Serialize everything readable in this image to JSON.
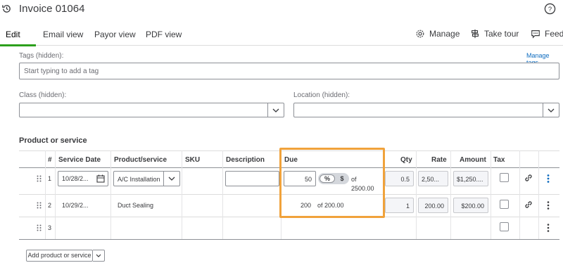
{
  "header": {
    "title": "Invoice 01064"
  },
  "tabs": [
    {
      "label": "Edit"
    },
    {
      "label": "Email view"
    },
    {
      "label": "Payor view"
    },
    {
      "label": "PDF view"
    }
  ],
  "actions": {
    "manage": "Manage",
    "take_tour": "Take tour",
    "feedback": "Feedb"
  },
  "tags": {
    "label": "Tags (hidden):",
    "manage_link": "Manage tags",
    "placeholder": "Start typing to add a tag"
  },
  "class_field": {
    "label": "Class (hidden):",
    "value": ""
  },
  "location_field": {
    "label": "Location (hidden):",
    "value": ""
  },
  "section_title": "Product or service",
  "table": {
    "headers": [
      "#",
      "Service Date",
      "Product/service",
      "SKU",
      "Description",
      "Due",
      "Qty",
      "Rate",
      "Amount",
      "Tax"
    ],
    "rows": [
      {
        "num": "1",
        "date": "10/28/2...",
        "product": "A/C Installation",
        "due_value": "50",
        "due_toggle_pct": "%",
        "due_toggle_dollar": "$",
        "due_of": "of",
        "due_total": "2500.00",
        "qty": "0.5",
        "rate": "2,50...",
        "amount": "$1,250...."
      },
      {
        "num": "2",
        "date": "10/29/2...",
        "product": "Duct Sealing",
        "due_value": "200",
        "due_of_text": "of 200.00",
        "qty": "1",
        "rate": "200.00",
        "amount": "$200.00"
      },
      {
        "num": "3"
      }
    ]
  },
  "add_button": "Add product or service",
  "colors": {
    "accent": "#2ca01c",
    "highlight": "#f0a23b",
    "link": "#0d6bbf"
  }
}
